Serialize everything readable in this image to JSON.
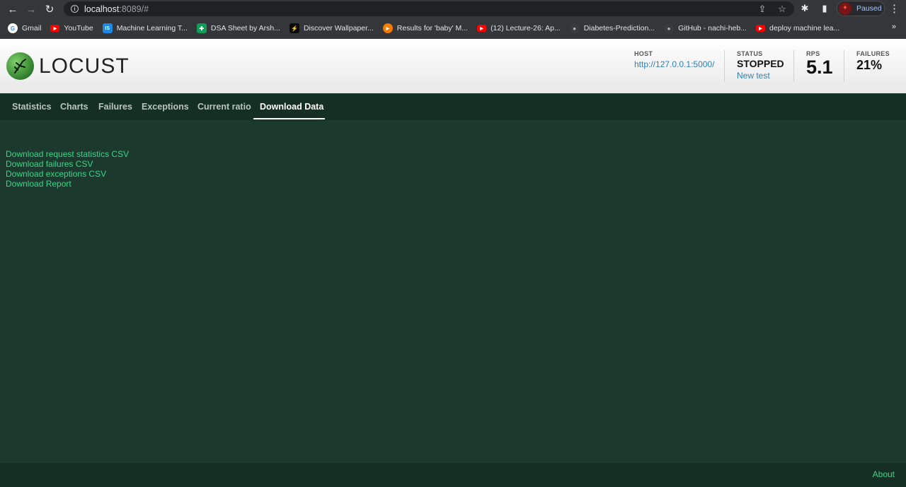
{
  "browser": {
    "url_host": "localhost",
    "url_rest": ":8089/#",
    "profile_label": "Paused",
    "bookmarks": [
      {
        "label": "Gmail",
        "icon": "gmail-icon",
        "color": "#ffffff",
        "glyph": "G"
      },
      {
        "label": "YouTube",
        "icon": "youtube-icon",
        "color": "#ff0000",
        "glyph": "▶"
      },
      {
        "label": "Machine Learning T...",
        "icon": "is-icon",
        "color": "#1e88e5",
        "glyph": "IS"
      },
      {
        "label": "DSA Sheet by Arsh...",
        "icon": "sheets-icon",
        "color": "#0f9d58",
        "glyph": "✚"
      },
      {
        "label": "Discover Wallpaper...",
        "icon": "wallpaper-icon",
        "color": "#0b0b0b",
        "glyph": "⚡"
      },
      {
        "label": "Results for 'baby' M...",
        "icon": "play-orange-icon",
        "color": "#f57c00",
        "glyph": "▶"
      },
      {
        "label": "(12) Lecture-26: Ap...",
        "icon": "youtube-icon",
        "color": "#ff0000",
        "glyph": "▶"
      },
      {
        "label": "Diabetes-Prediction...",
        "icon": "github-icon",
        "color": "#3a3b3e",
        "glyph": "●"
      },
      {
        "label": "GitHub - nachi-heb...",
        "icon": "github-icon",
        "color": "#3a3b3e",
        "glyph": "●"
      },
      {
        "label": "deploy machine lea...",
        "icon": "youtube-icon",
        "color": "#ff0000",
        "glyph": "▶"
      }
    ]
  },
  "header": {
    "logo_text": "LOCUST",
    "host_label": "HOST",
    "host_value": "http://127.0.0.1:5000/",
    "status_label": "STATUS",
    "status_value": "STOPPED",
    "new_test_label": "New test",
    "rps_label": "RPS",
    "rps_value": "5.1",
    "failures_label": "FAILURES",
    "failures_value": "21%"
  },
  "tabs": [
    {
      "label": "Statistics"
    },
    {
      "label": "Charts"
    },
    {
      "label": "Failures"
    },
    {
      "label": "Exceptions"
    },
    {
      "label": "Current ratio"
    },
    {
      "label": "Download Data"
    }
  ],
  "downloads": [
    {
      "label": "Download request statistics CSV"
    },
    {
      "label": "Download failures CSV"
    },
    {
      "label": "Download exceptions CSV"
    },
    {
      "label": "Download Report"
    }
  ],
  "footer": {
    "about_label": "About"
  },
  "colors": {
    "accent": "#3ed38a",
    "background": "#1b3a2d",
    "tab_bar": "#162f24",
    "link_blue": "#2f80b8"
  }
}
